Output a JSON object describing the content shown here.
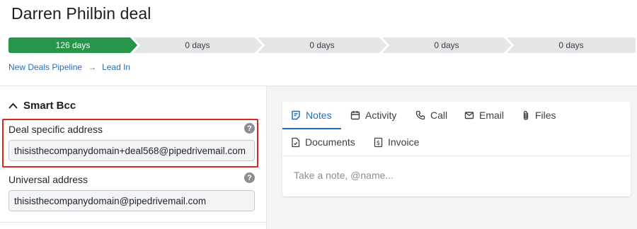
{
  "deal": {
    "title": "Darren Philbin deal"
  },
  "pipeline": {
    "stages": [
      {
        "label": "126 days",
        "active": true
      },
      {
        "label": "0 days",
        "active": false
      },
      {
        "label": "0 days",
        "active": false
      },
      {
        "label": "0 days",
        "active": false
      },
      {
        "label": "0 days",
        "active": false
      }
    ],
    "active_color": "#26954a",
    "inactive_color": "#e4e5e7"
  },
  "breadcrumb": {
    "pipeline": "New Deals Pipeline",
    "stage": "Lead In"
  },
  "smart_bcc": {
    "title": "Smart Bcc",
    "deal_label": "Deal specific address",
    "deal_value": "thisisthecompanydomain+deal568@pipedrivemail.com",
    "universal_label": "Universal address",
    "universal_value": "thisisthecompanydomain@pipedrivemail.com",
    "help_glyph": "?"
  },
  "tabs": {
    "notes": "Notes",
    "activity": "Activity",
    "call": "Call",
    "email": "Email",
    "files": "Files",
    "documents": "Documents",
    "invoice": "Invoice"
  },
  "note": {
    "placeholder": "Take a note, @name..."
  },
  "colors": {
    "highlight": "#d42b1e",
    "link": "#1f6fbf"
  }
}
